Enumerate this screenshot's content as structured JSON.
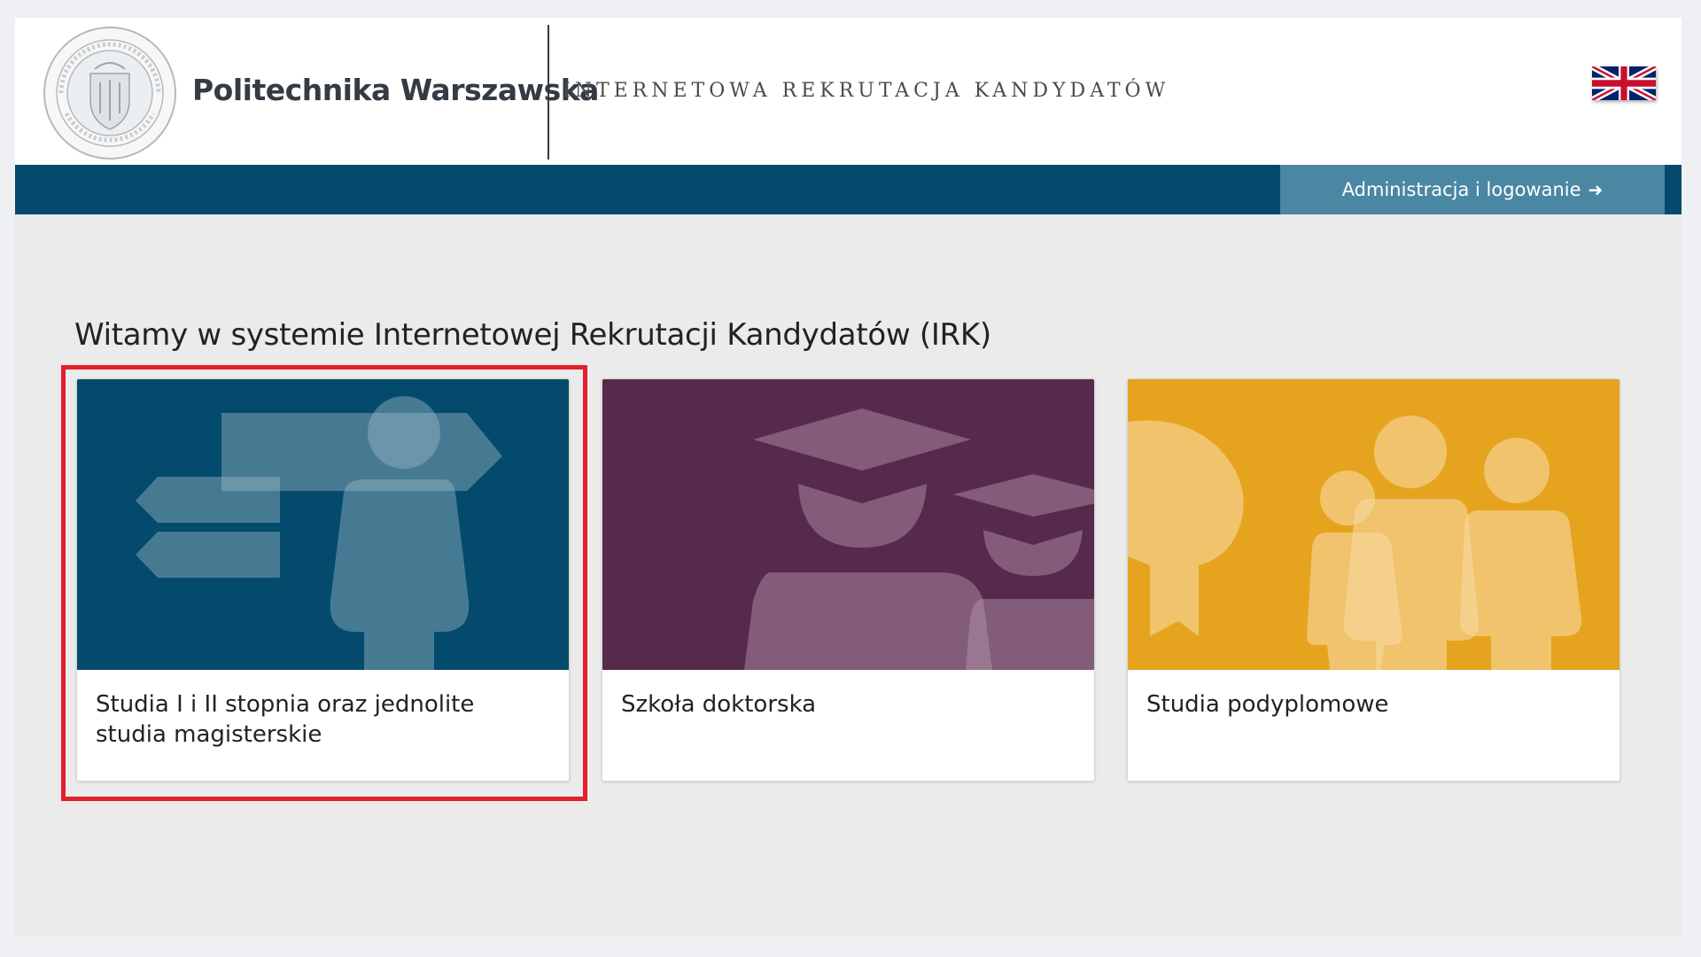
{
  "header": {
    "brand_name": "Politechnika Warszawska",
    "system_title": "Internetowa Rekrutacja Kandydatów",
    "seal_icon": "university-seal-icon",
    "language_flag_icon": "uk-flag-icon"
  },
  "navbar": {
    "login_label": "Administracja i logowanie",
    "login_arrow": "➜"
  },
  "main": {
    "welcome_title": "Witamy w systemie Internetowej Rekrutacji Kandydatów (IRK)",
    "cards": [
      {
        "label": "Studia I i II stopnia oraz jednolite studia magisterskie",
        "icon": "signpost-person-icon",
        "color": "#034a6c"
      },
      {
        "label": "Szkoła doktorska",
        "icon": "graduates-icon",
        "color": "#572a4d"
      },
      {
        "label": "Studia podyplomowe",
        "icon": "award-people-icon",
        "color": "#e6a31e"
      }
    ]
  },
  "colors": {
    "navbar": "#034a6c",
    "login_button": "#4a87a3",
    "highlight": "#e3202b"
  }
}
